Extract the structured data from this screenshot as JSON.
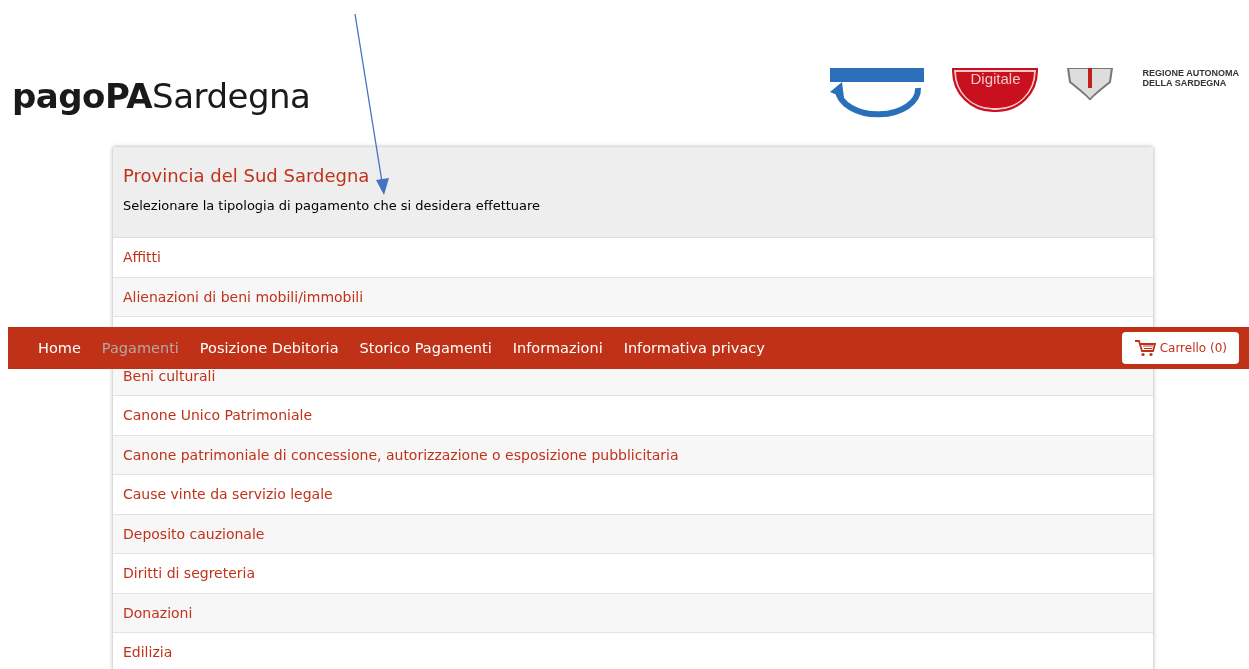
{
  "header": {
    "wordmark": "**pagoPA**Sardegna",
    "partner_logos": {
      "digitale_label": "Digitale",
      "region_line_1": "REGIONE AUTONOMA",
      "region_line_2": "DELLA SARDEGNA"
    }
  },
  "panel": {
    "title": "Provincia del Sud Sardegna",
    "subtitle": "Selezionare la tipologia di pagamento che si desidera effettuare",
    "items": [
      "Affitti",
      "Alienazioni di beni mobili/immobili",
      "Beni culturali",
      "Canone Unico Patrimoniale",
      "Canone patrimoniale di concessione, autorizzazione o esposizione pubblicitaria",
      "Cause vinte da servizio legale",
      "Deposito cauzionale",
      "Diritti di segreteria",
      "Donazioni",
      "Edilizia"
    ]
  },
  "navbar": {
    "items": [
      {
        "label": "Home",
        "selected": false
      },
      {
        "label": "Pagamenti",
        "selected": true
      },
      {
        "label": "Posizione Debitoria",
        "selected": false
      },
      {
        "label": "Storico Pagamenti",
        "selected": false
      },
      {
        "label": "Informazioni",
        "selected": false
      },
      {
        "label": "Informativa privacy",
        "selected": false
      }
    ],
    "cart_button": "Carrello (0)"
  }
}
